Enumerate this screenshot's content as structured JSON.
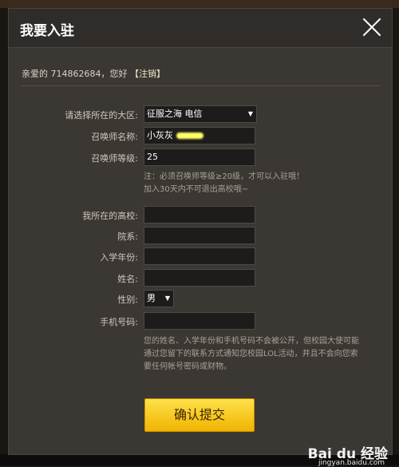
{
  "window": {
    "title": "我要入驻"
  },
  "account": {
    "greeting_prefix": "亲爱的 714862684，您好",
    "logout_label": "【注销】"
  },
  "form": {
    "region_label": "请选择所在的大区:",
    "region_value": "征服之海 电信",
    "summoner_name_label": "召唤师名称:",
    "summoner_name_value": "小灰灰",
    "summoner_level_label": "召唤师等级:",
    "summoner_level_value": "25",
    "level_note_line1": "注：必须召唤师等级≥20级，才可以入驻哦！",
    "level_note_line2": "加入30天内不可退出高校哦~",
    "school_label": "我所在的高校:",
    "school_value": "",
    "department_label": "院系:",
    "department_value": "",
    "enroll_year_label": "入学年份:",
    "enroll_year_value": "",
    "name_label": "姓名:",
    "name_value": "",
    "gender_label": "性别:",
    "gender_value": "男",
    "phone_label": "手机号码:",
    "phone_value": "",
    "privacy_line1": "您的姓名、入学年份和手机号码不会被公开，但校园大使可能",
    "privacy_line2": "通过您留下的联系方式通知您校园LOL活动，并且不会向您索",
    "privacy_line3": "要任何帐号密码或财物。"
  },
  "actions": {
    "submit_label": "确认提交"
  },
  "watermark": {
    "brand": "Bai du 经验",
    "site": "jingyan.baidu.com"
  },
  "colors": {
    "panel": "#3b3733",
    "button": "#f6c400",
    "text": "#cfc8bc"
  }
}
